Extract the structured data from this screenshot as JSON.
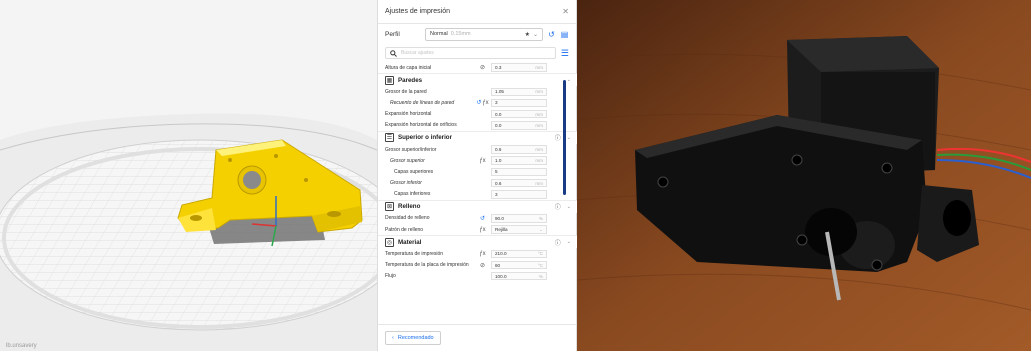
{
  "viewport": {
    "footer_text": "lb.unsavery"
  },
  "panel": {
    "title": "Ajustes de impresión",
    "close_icon": "close-icon",
    "profile": {
      "label": "Perfil",
      "selected": "Normal",
      "selected_sub": "0.15mm"
    },
    "search_placeholder": "Buscar ajustes",
    "top_settings": [
      {
        "label": "Altura de capa inicial",
        "icon": "link-icon",
        "value": "0.3",
        "unit": "mm"
      }
    ],
    "categories": [
      {
        "name": "Paredes",
        "icon_glyph": "▦",
        "has_info": false,
        "rows": [
          {
            "label": "Grosor de la pared",
            "value": "1.05",
            "unit": "mm",
            "icon": "",
            "style": ""
          },
          {
            "label": "Recuento de líneas de pared",
            "value": "3",
            "unit": "",
            "icon": "reset+fx",
            "style": "it ind"
          },
          {
            "label": "Expansión horizontal",
            "value": "0.0",
            "unit": "mm",
            "icon": "",
            "style": ""
          },
          {
            "label": "Expansión horizontal de orificios",
            "value": "0.0",
            "unit": "mm",
            "icon": "",
            "style": ""
          }
        ]
      },
      {
        "name": "Superior o inferior",
        "icon_glyph": "☰",
        "has_info": true,
        "rows": [
          {
            "label": "Grosor superior/inferior",
            "value": "0.6",
            "unit": "mm",
            "icon": "",
            "style": ""
          },
          {
            "label": "Grosor superior",
            "value": "1.0",
            "unit": "mm",
            "icon": "fx",
            "style": "it ind"
          },
          {
            "label": "Capas superiores",
            "value": "5",
            "unit": "",
            "icon": "",
            "style": "ind2"
          },
          {
            "label": "Grosor inferior",
            "value": "0.6",
            "unit": "mm",
            "icon": "",
            "style": "it ind"
          },
          {
            "label": "Capas inferiores",
            "value": "3",
            "unit": "",
            "icon": "",
            "style": "ind2"
          }
        ]
      },
      {
        "name": "Relleno",
        "icon_glyph": "⊠",
        "has_info": true,
        "rows": [
          {
            "label": "Densidad de relleno",
            "value": "90.0",
            "unit": "%",
            "icon": "reset",
            "style": ""
          },
          {
            "label": "Patrón de relleno",
            "value": "Rejilla",
            "unit": "⌄",
            "icon": "fx",
            "style": ""
          }
        ]
      },
      {
        "name": "Material",
        "icon_glyph": "◎",
        "has_info": true,
        "rows": [
          {
            "label": "Temperatura de impresión",
            "value": "210.0",
            "unit": "°C",
            "icon": "fx",
            "style": ""
          },
          {
            "label": "Temperatura de la placa de impresión",
            "value": "60",
            "unit": "°C",
            "icon": "link",
            "style": ""
          },
          {
            "label": "Flujo",
            "value": "100.0",
            "unit": "%",
            "icon": "",
            "style": ""
          }
        ]
      }
    ],
    "footer_button": "Recomendado"
  },
  "colors": {
    "accent": "#196ef0",
    "model": "#f5d000",
    "scrollbar": "#183b84"
  }
}
